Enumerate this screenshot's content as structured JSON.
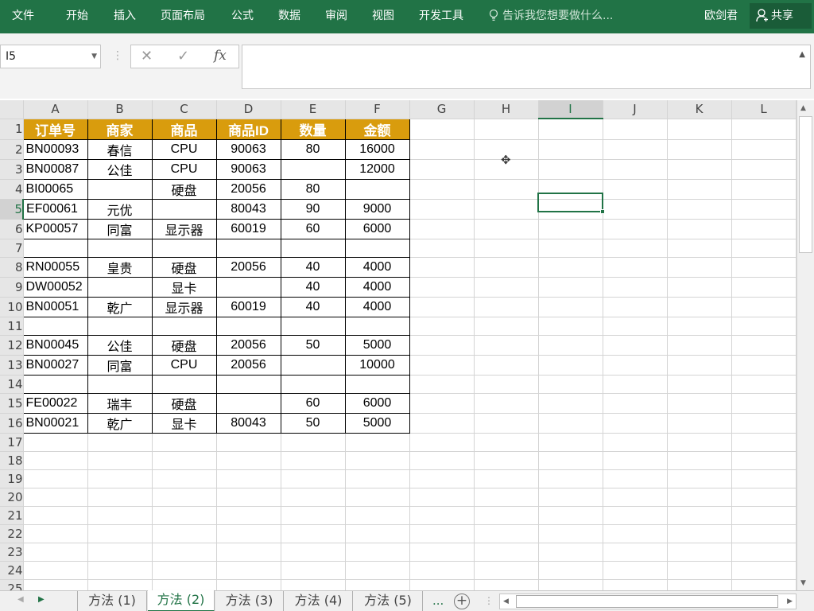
{
  "ribbon": {
    "tabs": [
      "文件",
      "开始",
      "插入",
      "页面布局",
      "公式",
      "数据",
      "审阅",
      "视图",
      "开发工具"
    ],
    "search_placeholder": "告诉我您想要做什么...",
    "user": "欧剑君",
    "share": "共享"
  },
  "formula_bar": {
    "name_box": "I5",
    "fx_label": "fx",
    "value": ""
  },
  "grid": {
    "columns": [
      "A",
      "B",
      "C",
      "D",
      "E",
      "F",
      "G",
      "H",
      "I",
      "J",
      "K",
      "L"
    ],
    "active_column": "I",
    "active_row": 5,
    "row_count": 26,
    "table_header": [
      "订单号",
      "商家",
      "商品",
      "商品ID",
      "数量",
      "金额"
    ],
    "rows": [
      [
        "BN00093",
        "春信",
        "CPU",
        "90063",
        "80",
        "16000"
      ],
      [
        "BN00087",
        "公佳",
        "CPU",
        "90063",
        "",
        "12000"
      ],
      [
        "BI00065",
        "",
        "硬盘",
        "20056",
        "80",
        ""
      ],
      [
        "EF00061",
        "元优",
        "",
        "80043",
        "90",
        "9000"
      ],
      [
        "KP00057",
        "同富",
        "显示器",
        "60019",
        "60",
        "6000"
      ],
      [
        "",
        "",
        "",
        "",
        "",
        ""
      ],
      [
        "RN00055",
        "皇贵",
        "硬盘",
        "20056",
        "40",
        "4000"
      ],
      [
        "DW00052",
        "",
        "显卡",
        "",
        "40",
        "4000"
      ],
      [
        "BN00051",
        "乾广",
        "显示器",
        "60019",
        "40",
        "4000"
      ],
      [
        "",
        "",
        "",
        "",
        "",
        ""
      ],
      [
        "BN00045",
        "公佳",
        "硬盘",
        "20056",
        "50",
        "5000"
      ],
      [
        "BN00027",
        "同富",
        "CPU",
        "20056",
        "",
        "10000"
      ],
      [
        "",
        "",
        "",
        "",
        "",
        ""
      ],
      [
        "FE00022",
        "瑞丰",
        "硬盘",
        "",
        "60",
        "6000"
      ],
      [
        "BN00021",
        "乾广",
        "显卡",
        "80043",
        "50",
        "5000"
      ]
    ],
    "header_color": "#d99c0d",
    "accent_color": "#217346"
  },
  "sheet_tabs": {
    "tabs": [
      "方法 (1)",
      "方法 (2)",
      "方法 (3)",
      "方法 (4)",
      "方法 (5)"
    ],
    "active_index": 1,
    "more": "...",
    "add": "+"
  }
}
